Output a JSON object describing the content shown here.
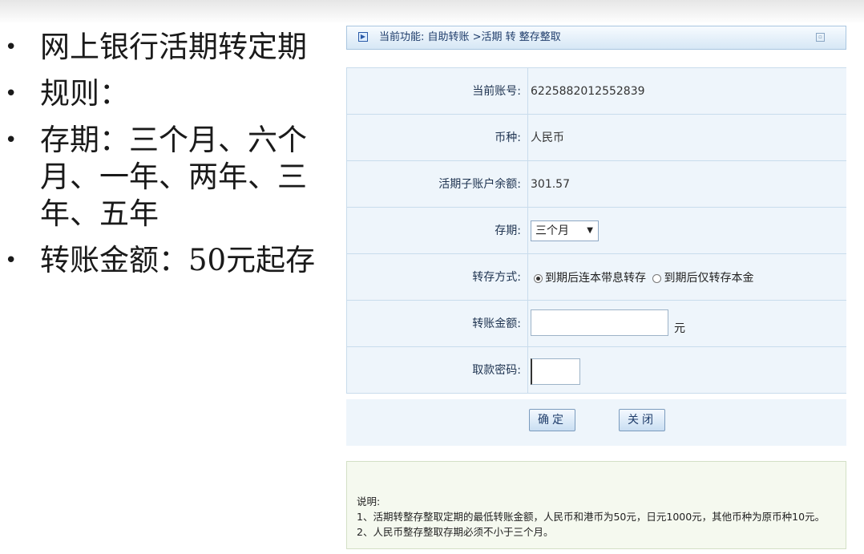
{
  "slide": {
    "bullets": [
      "网上银行活期转定期",
      "规则：",
      "存期：三个月、六个月、一年、两年、三年、五年",
      "转账金额：50元起存"
    ]
  },
  "panel": {
    "title": "当前功能:  自助转账 >活期 转 整存整取",
    "fields": {
      "account_label": "当前账号:",
      "account_value": "6225882012552839",
      "currency_label": "币种:",
      "currency_value": "人民币",
      "balance_label": "活期子账户余额:",
      "balance_value": "301.57",
      "term_label": "存期:",
      "term_selected": "三个月",
      "mode_label": "转存方式:",
      "mode_option_1": "到期后连本带息转存",
      "mode_option_2": "到期后仅转存本金",
      "amount_label": "转账金额:",
      "amount_value": "",
      "amount_unit": "元",
      "password_label": "取款密码:"
    },
    "buttons": {
      "confirm": "确定",
      "close": "关闭"
    },
    "notes": {
      "heading": "说明:",
      "line1": "1、活期转整存整取定期的最低转账金额，人民币和港币为50元，日元1000元，其他币种为原币种10元。",
      "line2": "2、人民币整存整取存期必须不小于三个月。"
    }
  },
  "colors": {
    "panel_bg": "#eef5fb",
    "border": "#c9dcec",
    "title_text": "#1f3d6b"
  }
}
